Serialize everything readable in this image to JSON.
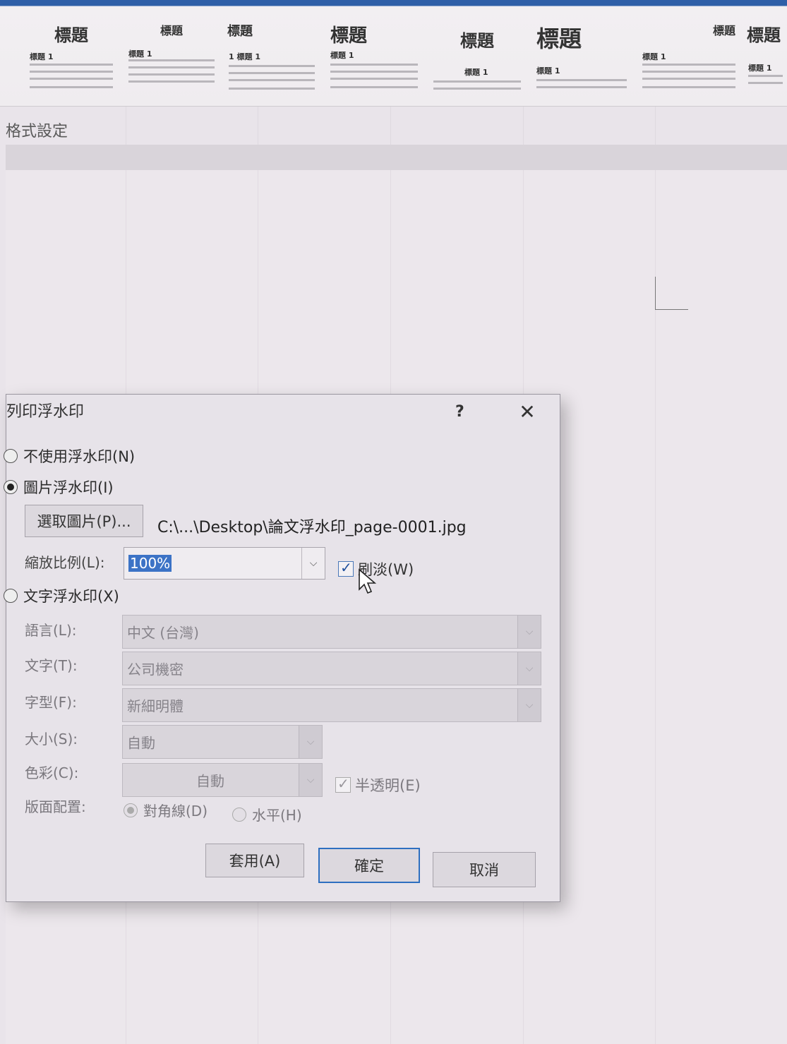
{
  "gallery": {
    "themes": [
      {
        "title": "標題",
        "sub": "標題 1"
      },
      {
        "title": "標題",
        "sub": "標題 1"
      },
      {
        "title": "標題",
        "sub": "1 標題 1"
      },
      {
        "title": "標題",
        "sub": "標題 1"
      },
      {
        "title": "標題",
        "sub": "標題 1"
      },
      {
        "title": "標題",
        "sub": "標題 1"
      },
      {
        "title": "標題",
        "sub": "標題 1"
      },
      {
        "title": "標題",
        "sub": "標題 1"
      }
    ]
  },
  "section_label": "格式設定",
  "dialog": {
    "title": "列印浮水印",
    "help": "?",
    "close": "✕",
    "no_watermark": "不使用浮水印(N)",
    "picture_watermark": "圖片浮水印(I)",
    "select_picture_button": "選取圖片(P)...",
    "picture_path": "C:\\...\\Desktop\\論文浮水印_page-0001.jpg",
    "scale_label": "縮放比例(L):",
    "scale_value": "100%",
    "washout_label": "刷淡(W)",
    "washout_checked": true,
    "text_watermark": "文字浮水印(X)",
    "language_label": "語言(L):",
    "language_value": "中文 (台灣)",
    "text_label": "文字(T):",
    "text_value": "公司機密",
    "font_label": "字型(F):",
    "font_value": "新細明體",
    "size_label": "大小(S):",
    "size_value": "自動",
    "color_label": "色彩(C):",
    "color_value": "自動",
    "semitransparent_label": "半透明(E)",
    "layout_label": "版面配置:",
    "diagonal_label": "對角線(D)",
    "horizontal_label": "水平(H)",
    "apply_button": "套用(A)",
    "ok_button": "確定",
    "cancel_button": "取消"
  }
}
